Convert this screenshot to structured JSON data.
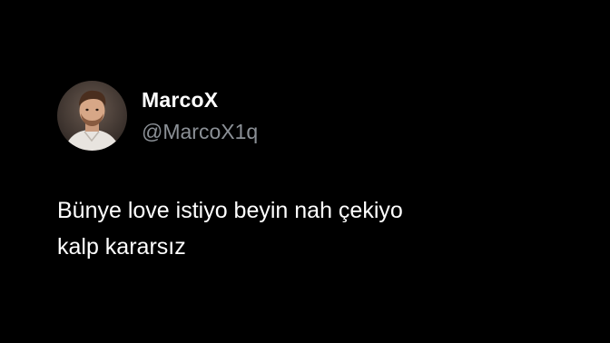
{
  "tweet": {
    "author": {
      "display_name": "MarcoX",
      "handle": "@MarcoX1q",
      "avatar_icon": "profile-photo"
    },
    "text_lines": [
      "Bünye love istiyo beyin nah çekiyo",
      "kalp kararsız"
    ]
  },
  "colors": {
    "background": "#000000",
    "text_primary": "#ffffff",
    "text_secondary": "#8b9096"
  }
}
